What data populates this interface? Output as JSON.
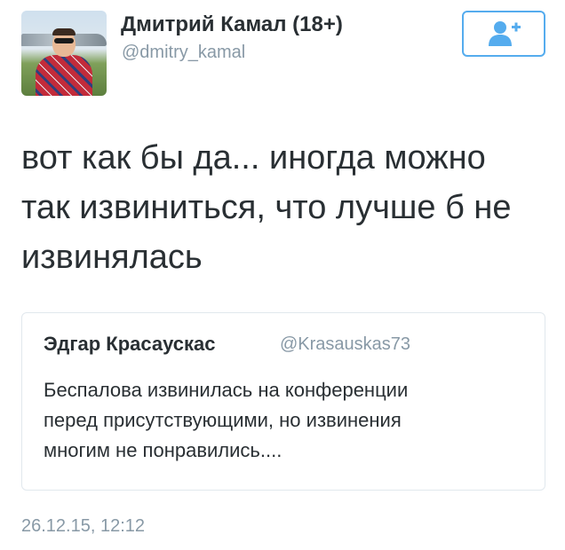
{
  "author": {
    "name": "Дмитрий Камал (18+)",
    "handle": "@dmitry_kamal",
    "avatar_icon": "profile-photo"
  },
  "follow_button": {
    "icon": "add-user-icon",
    "accent": "#55acee"
  },
  "tweet": {
    "lines": [
      "вот как бы да... иногда можно",
      "так извиниться, что лучше б не",
      "извинялась"
    ],
    "timestamp": "26.12.15, 12:12"
  },
  "quoted_tweet": {
    "name": "Эдгар Красаускас",
    "handle": "@Krasauskas73",
    "lines": [
      "Беспалова извинилась на конференции",
      "перед присутствующими, но извинения",
      "многим не понравились...."
    ]
  },
  "colors": {
    "text": "#292f33",
    "muted": "#8899a6",
    "border": "#e1e8ed"
  }
}
